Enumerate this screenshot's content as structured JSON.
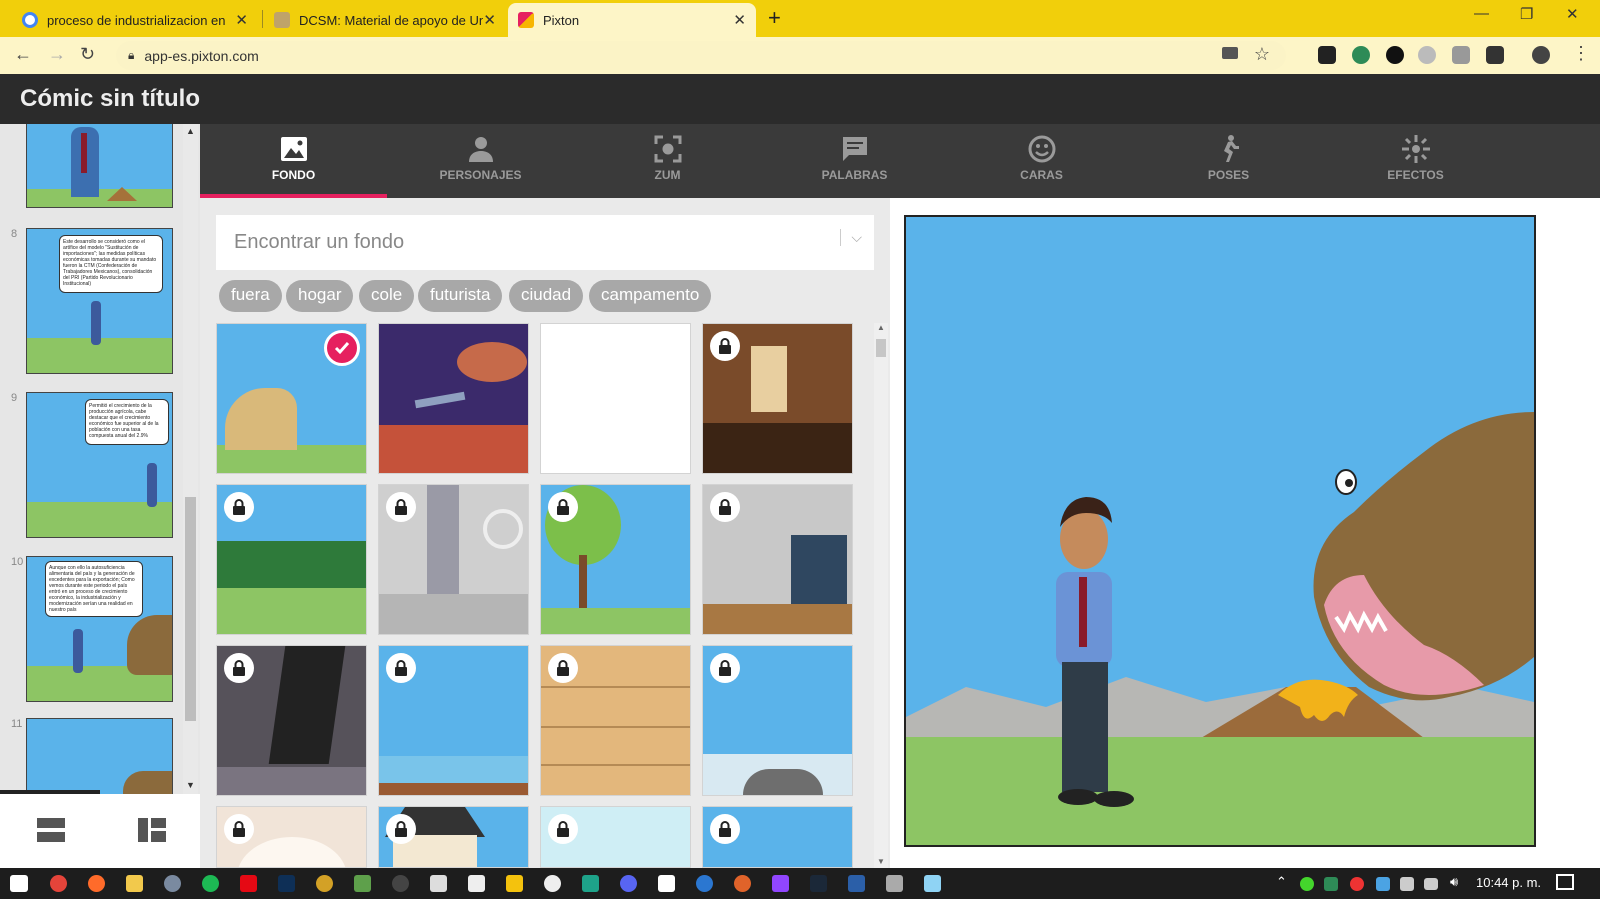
{
  "browser": {
    "tabs": [
      {
        "title": "proceso de industrializacion en m",
        "favicon": "google-icon"
      },
      {
        "title": "DCSM: Material de apoyo de Uni",
        "favicon": "dcsm-icon"
      },
      {
        "title": "Pixton",
        "favicon": "pixton-icon"
      }
    ],
    "url": "app-es.pixton.com",
    "accent": "#f1cf0b"
  },
  "app": {
    "title": "Cómic sin título"
  },
  "strip": {
    "panel_numbers": [
      "8",
      "9",
      "10",
      "11"
    ],
    "panel_8_text": "Este desarrollo se consideró como el artífice del modelo \"Sustitución de importaciones\"; las medidas políticas económicas tomadas durante su mandato fueron la CTM (Confederación de Trabajadores Mexicanos), consolidación del PRI (Partido Revolucionario Institucional)",
    "panel_9_text": "Permitió el crecimiento de la producción agrícola, cabe destacar que el crecimiento económico fue superior al de la población con una tasa compuesta anual del 2.9%",
    "panel_10_text": "Aunque con ello la autosuficiencia alimentaria del país y la generación de excedentes para la exportación; Como vemos durante este periodo el país entró en un proceso de crecimiento económico, la industrialización y modernización serían una realidad en nuestro país"
  },
  "tools": [
    {
      "label": "FONDO",
      "icon": "image-icon",
      "active": true
    },
    {
      "label": "PERSONAJES",
      "icon": "person-icon",
      "active": false
    },
    {
      "label": "ZUM",
      "icon": "zoom-frame-icon",
      "active": false
    },
    {
      "label": "PALABRAS",
      "icon": "speech-bubble-icon",
      "active": false
    },
    {
      "label": "CARAS",
      "icon": "smiley-icon",
      "active": false
    },
    {
      "label": "POSES",
      "icon": "running-person-icon",
      "active": false
    },
    {
      "label": "EFECTOS",
      "icon": "sparkle-icon",
      "active": false
    }
  ],
  "background_panel": {
    "search_placeholder": "Encontrar un fondo",
    "categories": [
      "fuera",
      "hogar",
      "cole",
      "futurista",
      "ciudad",
      "campamento"
    ],
    "tiles": [
      {
        "name": "dinosaur-landscape",
        "locked": false,
        "selected": true
      },
      {
        "name": "space-planet",
        "locked": false,
        "selected": false
      },
      {
        "name": "blank-white",
        "locked": false,
        "selected": false
      },
      {
        "name": "dining-room",
        "locked": true,
        "selected": false
      },
      {
        "name": "forest-field",
        "locked": true,
        "selected": false
      },
      {
        "name": "futuristic-tower",
        "locked": true,
        "selected": false
      },
      {
        "name": "park-bike",
        "locked": true,
        "selected": false
      },
      {
        "name": "school-hallway",
        "locked": true,
        "selected": false
      },
      {
        "name": "rocky-tunnel",
        "locked": true,
        "selected": false
      },
      {
        "name": "sea-dock",
        "locked": true,
        "selected": false
      },
      {
        "name": "wood-floor",
        "locked": true,
        "selected": false
      },
      {
        "name": "beach-rocks",
        "locked": true,
        "selected": false
      },
      {
        "name": "room-beige",
        "locked": true,
        "selected": false
      },
      {
        "name": "house-front",
        "locked": true,
        "selected": false
      },
      {
        "name": "light-room",
        "locked": true,
        "selected": false
      },
      {
        "name": "blue-sky",
        "locked": true,
        "selected": false
      }
    ]
  },
  "taskbar": {
    "time": "10:44 p. m."
  }
}
